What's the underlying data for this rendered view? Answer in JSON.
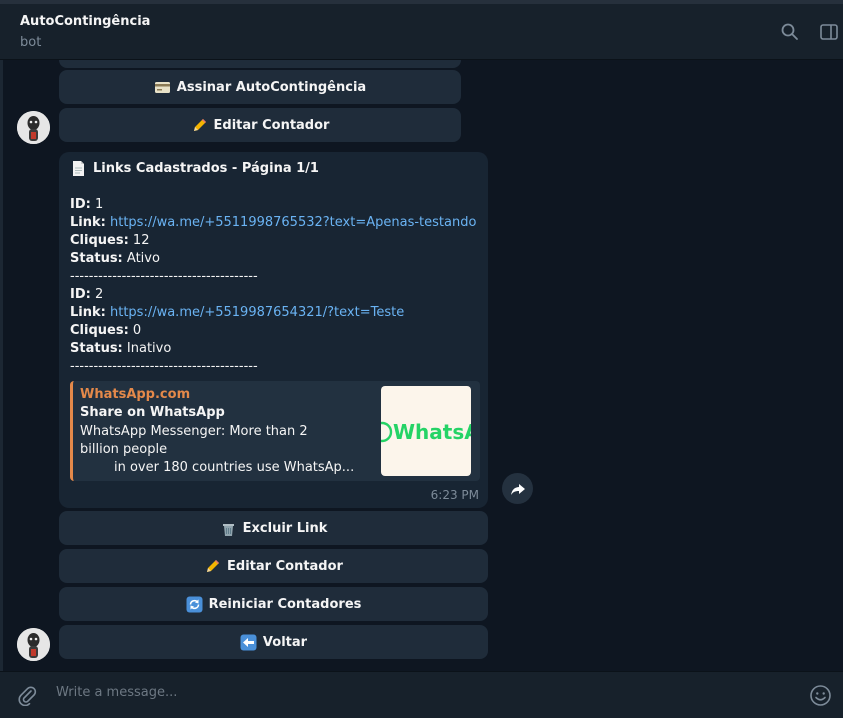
{
  "header": {
    "title": "AutoContingência",
    "subtitle": "bot"
  },
  "top_buttons": [
    {
      "emoji": "credit-card",
      "label": "Assinar AutoContingência"
    },
    {
      "emoji": "pencil",
      "label": "Editar Contador"
    }
  ],
  "message": {
    "heading_icon": "page",
    "heading": "Links Cadastrados - Página 1/1",
    "labels": {
      "id": "ID:",
      "link": "Link:",
      "clicks": "Cliques:",
      "status": "Status:"
    },
    "entries": [
      {
        "id": "1",
        "link": "https://wa.me/+5511998765532?text=Apenas-testando",
        "clicks": "12",
        "status": "Ativo"
      },
      {
        "id": "2",
        "link": "https://wa.me/+5519987654321/?text=Teste",
        "clicks": "0",
        "status": "Inativo"
      }
    ],
    "separator": "----------------------------------------",
    "preview": {
      "site": "WhatsApp.com",
      "title": "Share on WhatsApp",
      "desc_line1": "WhatsApp Messenger: More than 2 billion people",
      "desc_line2": "in over 180 countries use WhatsAp...",
      "image_text": "WhatsApp"
    },
    "time": "6:23 PM"
  },
  "bottom_buttons": [
    {
      "emoji": "wastebasket",
      "label": "Excluir Link"
    },
    {
      "emoji": "pencil",
      "label": "Editar Contador"
    },
    {
      "emoji": "arrows-cycle",
      "label": "Reiniciar Contadores"
    },
    {
      "emoji": "back-arrow",
      "label": "Voltar"
    }
  ],
  "composer": {
    "placeholder": "Write a message..."
  },
  "colors": {
    "accent_link": "#6ab3f3",
    "preview_accent": "#e4894a",
    "bubble": "#182533",
    "button": "#1f2c3a"
  }
}
